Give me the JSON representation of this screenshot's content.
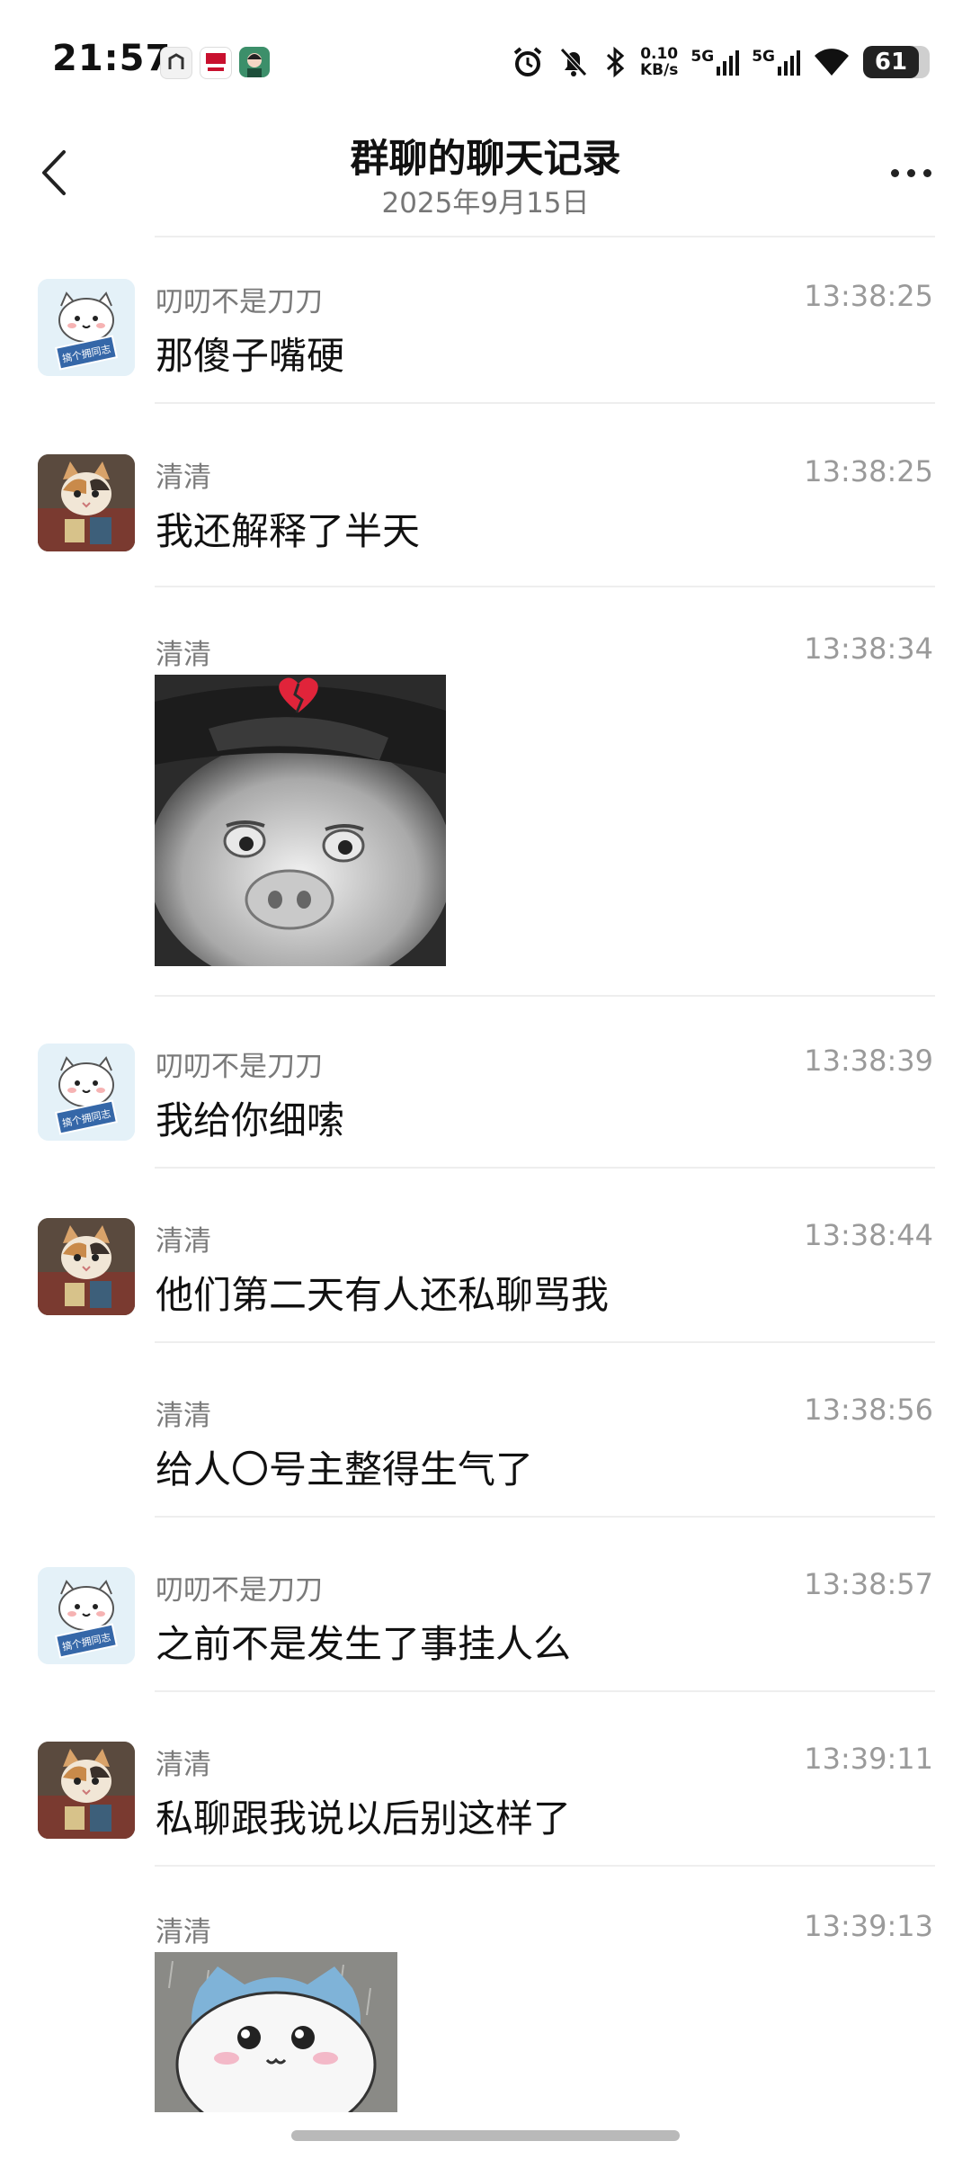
{
  "status_bar": {
    "time": "21:57",
    "net_speed_value": "0.10",
    "net_speed_unit": "KB/s",
    "sim1": "5G",
    "sim2": "5G",
    "battery": "61"
  },
  "header": {
    "title": "群聊的聊天记录",
    "subtitle": "2025年9月15日"
  },
  "messages": [
    {
      "sender": "叨叨不是刀刀",
      "time": "13:38:25",
      "text": "那傻子嘴硬",
      "avatar": "white-cat-sign",
      "avatar_sign": "搞个拥同志"
    },
    {
      "sender": "清清",
      "time": "13:38:25",
      "text": "我还解释了半天",
      "avatar": "calico-cat"
    },
    {
      "sender": "清清",
      "time": "13:38:34",
      "sticker": "gray-pig-broken-heart"
    },
    {
      "sender": "叨叨不是刀刀",
      "time": "13:38:39",
      "text": "我给你细嗦",
      "avatar": "white-cat-sign",
      "avatar_sign": "搞个拥同志"
    },
    {
      "sender": "清清",
      "time": "13:38:44",
      "text": "他们第二天有人还私聊骂我",
      "avatar": "calico-cat"
    },
    {
      "sender": "清清",
      "time": "13:38:56",
      "text": "给人〇号主整得生气了"
    },
    {
      "sender": "叨叨不是刀刀",
      "time": "13:38:57",
      "text": "之前不是发生了事挂人么",
      "avatar": "white-cat-sign",
      "avatar_sign": "搞个拥同志"
    },
    {
      "sender": "清清",
      "time": "13:39:11",
      "text": "私聊跟我说以后别这样了",
      "avatar": "calico-cat"
    },
    {
      "sender": "清清",
      "time": "13:39:13",
      "sticker": "crying-white-creature"
    }
  ],
  "colors": {
    "text_primary": "#111111",
    "text_secondary": "#7a7a7a",
    "divider": "#eeeeee",
    "background": "#ffffff"
  }
}
